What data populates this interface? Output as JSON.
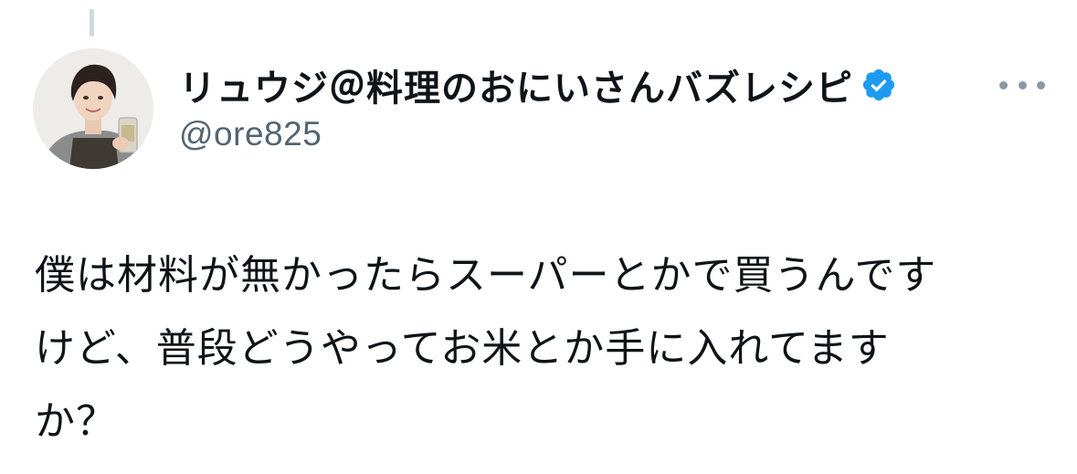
{
  "author": {
    "display_name": "リュウジ＠料理のおにいさんバズレシピ",
    "handle": "@ore825",
    "verified": true,
    "avatar_icon": "avatar-photo"
  },
  "menu": {
    "icon": "more-horizontal-icon"
  },
  "tweet": {
    "lines": [
      "僕は材料が無かったらスーパーとかで買うんです",
      "けど、普段どうやってお米とか手に入れてます",
      "か？"
    ]
  },
  "colors": {
    "text": "#0f1419",
    "secondary": "#536471",
    "verified_blue": "#1d9bf0",
    "thread_line": "#cfd9de"
  }
}
